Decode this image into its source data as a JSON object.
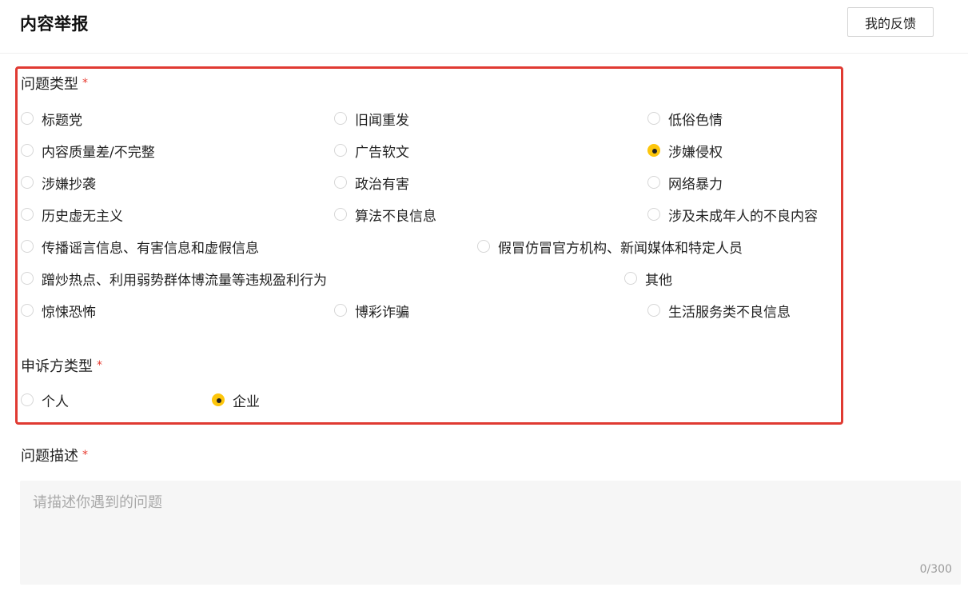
{
  "header": {
    "title": "内容举报",
    "feedback_button": "我的反馈"
  },
  "problem_type": {
    "label": "问题类型",
    "required_mark": "*",
    "options": [
      {
        "label": "标题党",
        "checked": false
      },
      {
        "label": "旧闻重发",
        "checked": false
      },
      {
        "label": "低俗色情",
        "checked": false
      },
      {
        "label": "内容质量差/不完整",
        "checked": false
      },
      {
        "label": "广告软文",
        "checked": false
      },
      {
        "label": "涉嫌侵权",
        "checked": true
      },
      {
        "label": "涉嫌抄袭",
        "checked": false
      },
      {
        "label": "政治有害",
        "checked": false
      },
      {
        "label": "网络暴力",
        "checked": false
      },
      {
        "label": "历史虚无主义",
        "checked": false
      },
      {
        "label": "算法不良信息",
        "checked": false
      },
      {
        "label": "涉及未成年人的不良内容",
        "checked": false
      },
      {
        "label": "传播谣言信息、有害信息和虚假信息",
        "checked": false
      },
      {
        "label": "假冒仿冒官方机构、新闻媒体和特定人员",
        "checked": false
      },
      {
        "label": "蹭炒热点、利用弱势群体博流量等违规盈利行为",
        "checked": false
      },
      {
        "label": "其他",
        "checked": false
      },
      {
        "label": "惊悚恐怖",
        "checked": false
      },
      {
        "label": "博彩诈骗",
        "checked": false
      },
      {
        "label": "生活服务类不良信息",
        "checked": false
      }
    ]
  },
  "complainant_type": {
    "label": "申诉方类型",
    "required_mark": "*",
    "options": [
      {
        "label": "个人",
        "checked": false
      },
      {
        "label": "企业",
        "checked": true
      }
    ]
  },
  "description": {
    "label": "问题描述",
    "required_mark": "*",
    "placeholder": "请描述你遇到的问题",
    "char_count": "0/300"
  },
  "colors": {
    "accent": "#fdc60c",
    "required": "#e83b30",
    "highlight_border": "#e03a32"
  }
}
